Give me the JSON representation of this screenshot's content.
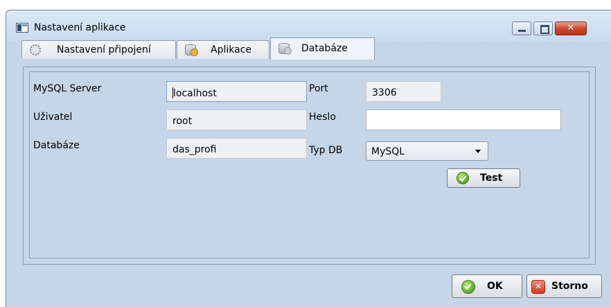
{
  "window": {
    "title": "Nastavení aplikace",
    "controls": {
      "minimize": "minimize-icon",
      "maximize": "maximize-icon",
      "close": "close-icon"
    }
  },
  "tabs": [
    {
      "label": "Nastavení připojení",
      "icon": "gear-icon",
      "active": false
    },
    {
      "label": "Aplikace",
      "icon": "database-key-icon",
      "active": false
    },
    {
      "label": "Databáze",
      "icon": "database-gear-icon",
      "active": true
    }
  ],
  "form": {
    "server_label": "MySQL Server",
    "server_value": "localhost",
    "port_label": "Port",
    "port_value": "3306",
    "user_label": "Uživatel",
    "user_value": "root",
    "password_label": "Heslo",
    "password_value": "",
    "database_label": "Databáze",
    "database_value": "das_profi",
    "dbtype_label": "Typ DB",
    "dbtype_value": "MySQL",
    "test_button": "Test"
  },
  "footer": {
    "ok_button": "OK",
    "cancel_button": "Storno"
  },
  "colors": {
    "window_bg": "#c6d6e9",
    "close_button": "#c8442a",
    "ok_icon": "#5aa526",
    "cancel_icon": "#d23a22"
  }
}
